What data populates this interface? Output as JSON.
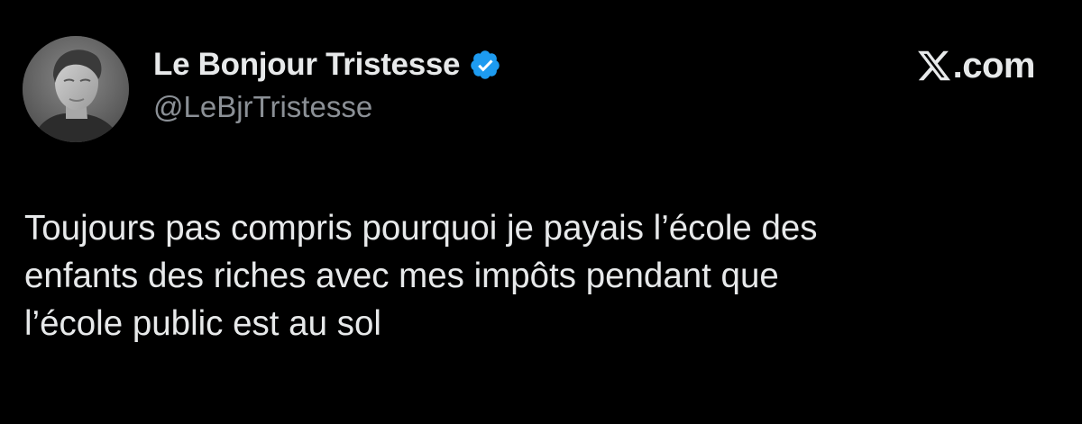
{
  "author": {
    "display_name": "Le Bonjour Tristesse",
    "handle": "@LeBjrTristesse",
    "verified": true,
    "verified_color": "#1d9bf0"
  },
  "brand": {
    "logo_icon": "x-logo-icon",
    "suffix": ".com"
  },
  "tweet": {
    "lines": [
      "Toujours pas compris pourquoi je payais l’école des",
      "enfants des riches avec mes impôts pendant que",
      "l’école public est au sol"
    ]
  },
  "colors": {
    "background": "#000000",
    "text_primary": "#e7e9ea",
    "text_secondary": "#8b9096"
  }
}
